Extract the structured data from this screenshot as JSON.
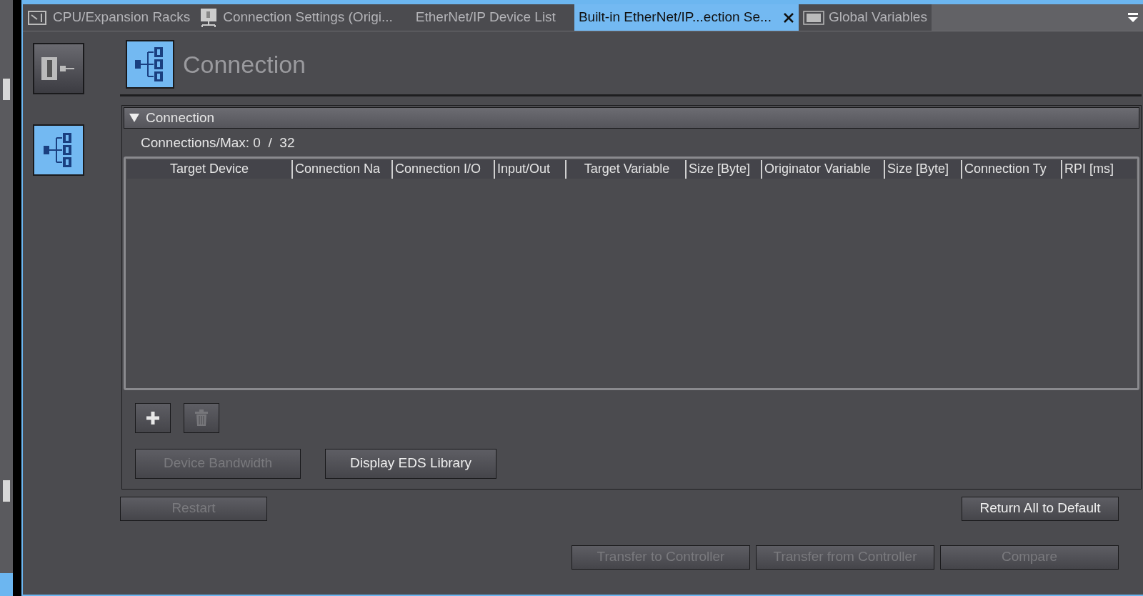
{
  "tabs": [
    {
      "label": "CPU/Expansion Racks",
      "kind": "racks",
      "selected": false,
      "closable": false
    },
    {
      "label": "Connection Settings (Origi...",
      "kind": "device",
      "selected": false,
      "closable": false
    },
    {
      "label": "EtherNet/IP Device List",
      "kind": "plain",
      "selected": false,
      "closable": false
    },
    {
      "label": "Built-in EtherNet/IP...ection Se...",
      "kind": "plain",
      "selected": true,
      "closable": true
    },
    {
      "label": "Global Variables",
      "kind": "variables",
      "selected": false,
      "closable": false
    }
  ],
  "nav": [
    {
      "kind": "module",
      "selected": false
    },
    {
      "kind": "connection",
      "selected": true
    }
  ],
  "page_title": "Connection",
  "section": {
    "title": "Connection",
    "expanded": true,
    "count_label": "Connections/Max: 0  /  32",
    "table": {
      "columns": [
        "Target Device",
        "Connection Na",
        "Connection I/O",
        "Input/Out",
        "Target Variable",
        "Size [Byte]",
        "Originator Variable",
        "Size [Byte]",
        "Connection Ty",
        "RPI [ms]"
      ]
    },
    "icon_buttons": [
      {
        "kind": "add",
        "disabled": false
      },
      {
        "kind": "delete",
        "disabled": true
      }
    ],
    "buttons": [
      {
        "label": "Device Bandwidth",
        "disabled": true
      },
      {
        "label": "Display EDS Library",
        "disabled": false
      }
    ]
  },
  "restart_button": {
    "label": "Restart",
    "disabled": true
  },
  "default_button": {
    "label": "Return All to Default",
    "disabled": false
  },
  "footer_buttons": [
    {
      "label": "Transfer to Controller",
      "disabled": true
    },
    {
      "label": "Transfer from Controller",
      "disabled": true
    },
    {
      "label": "Compare",
      "disabled": true
    }
  ]
}
